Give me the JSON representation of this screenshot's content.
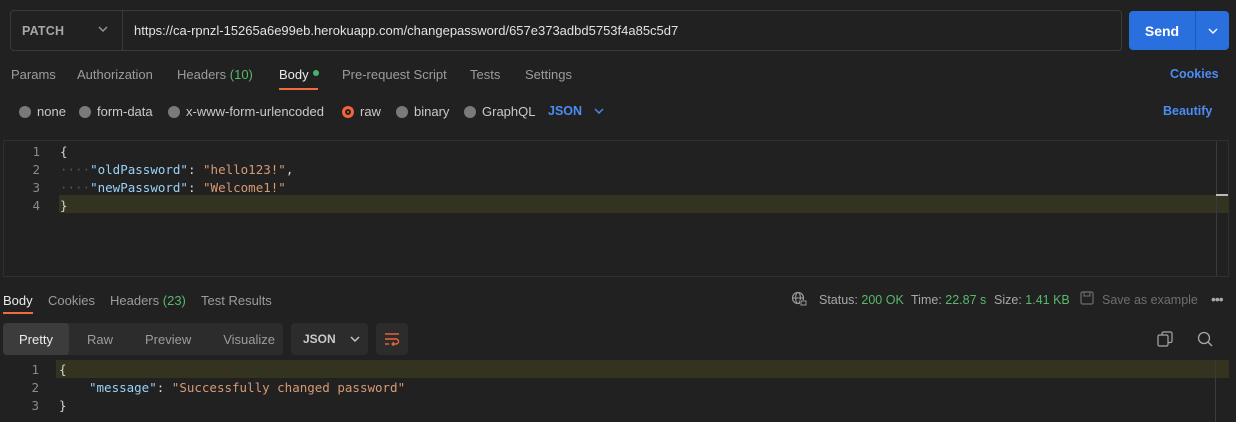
{
  "request": {
    "method": "PATCH",
    "url": "https://ca-rpnzl-15265a6e99eb.herokuapp.com/changepassword/657e373adbd5753f4a85c5d7",
    "send_label": "Send"
  },
  "tabs": [
    {
      "label": "Params"
    },
    {
      "label": "Authorization"
    },
    {
      "label": "Headers",
      "count": "(10)"
    },
    {
      "label": "Body"
    },
    {
      "label": "Pre-request Script"
    },
    {
      "label": "Tests"
    },
    {
      "label": "Settings"
    }
  ],
  "cookies_link": "Cookies",
  "body_types": [
    "none",
    "form-data",
    "x-www-form-urlencoded",
    "raw",
    "binary",
    "GraphQL"
  ],
  "body_format": "JSON",
  "beautify_label": "Beautify",
  "editor": {
    "line_numbers": [
      "1",
      "2",
      "3",
      "4"
    ],
    "open_brace": "{",
    "close_brace": "}",
    "key1": "\"oldPassword\"",
    "val1": "\"hello123!\"",
    "key2": "\"newPassword\"",
    "val2": "\"Welcome1!\""
  },
  "response": {
    "tabs": [
      {
        "label": "Body"
      },
      {
        "label": "Cookies"
      },
      {
        "label": "Headers",
        "count": "(23)"
      },
      {
        "label": "Test Results"
      }
    ],
    "status_label": "Status:",
    "status_value": "200 OK",
    "time_label": "Time:",
    "time_value": "22.87 s",
    "size_label": "Size:",
    "size_value": "1.41 KB",
    "save_label": "Save as example",
    "view_modes": [
      "Pretty",
      "Raw",
      "Preview",
      "Visualize"
    ],
    "format": "JSON",
    "line_numbers": [
      "1",
      "2",
      "3"
    ],
    "open_brace": "{",
    "close_brace": "}",
    "key": "\"message\"",
    "value": "\"Successfully changed password\""
  }
}
